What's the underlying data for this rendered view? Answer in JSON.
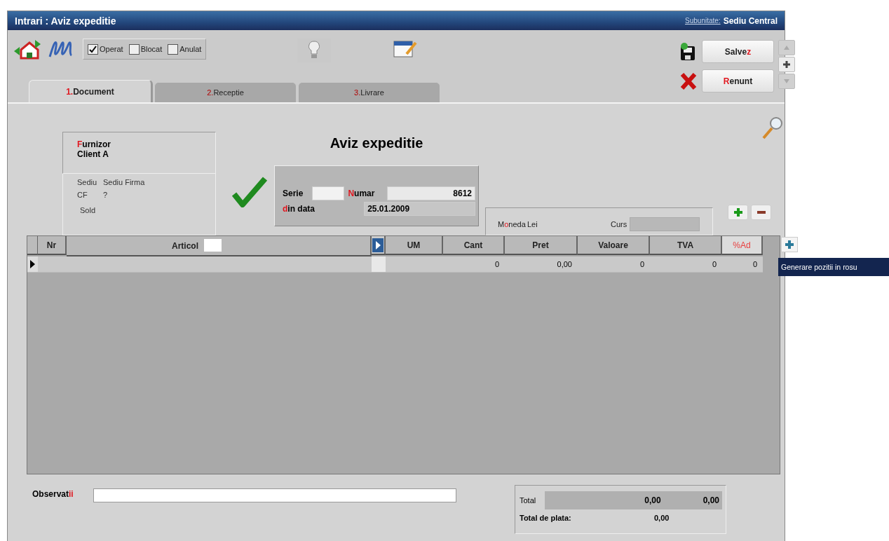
{
  "window": {
    "title": "Intrari : Aviz expeditie",
    "subunit_label": "Subunitate:",
    "subunit_value": "Sediu Central"
  },
  "toolbar": {
    "status_checks": [
      {
        "label": "Operat",
        "checked": true
      },
      {
        "label": "Blocat",
        "checked": false
      },
      {
        "label": "Anulat",
        "checked": false
      }
    ],
    "buttons": [
      {
        "kind": "save",
        "label": [
          {
            "text": "Salve",
            "hotkey": false
          },
          {
            "text": "z",
            "hotkey": true
          }
        ]
      },
      {
        "kind": "cancel",
        "label": [
          {
            "text": "R",
            "hotkey": true
          },
          {
            "text": "enunt",
            "hotkey": false
          }
        ]
      }
    ]
  },
  "tabs": [
    {
      "number": "1.",
      "label": "Document",
      "selected": true
    },
    {
      "number": "2.",
      "label": "Receptie",
      "selected": false
    },
    {
      "number": "3.",
      "label": "Livrare",
      "selected": false
    }
  ],
  "document": {
    "title": "Aviz expeditie",
    "supplier": {
      "label": [
        {
          "text": "F",
          "hotkey": true
        },
        {
          "text": "urnizor",
          "hotkey": false
        }
      ],
      "name": "Client A",
      "rows": [
        {
          "label": "Sediu",
          "value": "Sediu Firma"
        },
        {
          "label": "CF",
          "value": "?"
        }
      ],
      "balance_label": "Sold"
    },
    "serie": {
      "label": "Serie"
    },
    "numar": {
      "label": [
        {
          "text": "N",
          "hotkey": true
        },
        {
          "text": "umar",
          "hotkey": false
        }
      ],
      "value": "8612"
    },
    "date": {
      "label": [
        {
          "text": "d",
          "hotkey": true
        },
        {
          "text": "in data",
          "hotkey": false
        }
      ],
      "value": "25.01.2009"
    },
    "currency": {
      "label": [
        {
          "text": "M",
          "hotkey": false
        },
        {
          "text": "o",
          "hotkey": true
        },
        {
          "text": "neda",
          "hotkey": false
        }
      ],
      "value": "Lei",
      "rate_label": "Curs"
    }
  },
  "table": {
    "columns": [
      {
        "label": "Nr",
        "accent": false
      },
      {
        "label": "Articol",
        "accent": false
      },
      {
        "label": "UM",
        "accent": false
      },
      {
        "label": "Cant",
        "accent": false
      },
      {
        "label": "Pret",
        "accent": false
      },
      {
        "label": "Valoare",
        "accent": false
      },
      {
        "label": "TVA",
        "accent": false
      },
      {
        "label": "%Ad",
        "accent": true
      }
    ],
    "rows": [
      {
        "cant": "0",
        "pret": "0,00",
        "valoare": "0",
        "tva": "0",
        "ad": "0"
      }
    ]
  },
  "tooltip": "Generare pozitii in rosu",
  "footer": {
    "notes_label": [
      {
        "text": "Observat",
        "hotkey": false
      },
      {
        "text": "ii",
        "hotkey": true
      }
    ],
    "totals": {
      "label": "Total",
      "values": [
        "0,00",
        "0,00"
      ],
      "payable_label": "Total de plata:",
      "payable_value": "0,00"
    }
  }
}
